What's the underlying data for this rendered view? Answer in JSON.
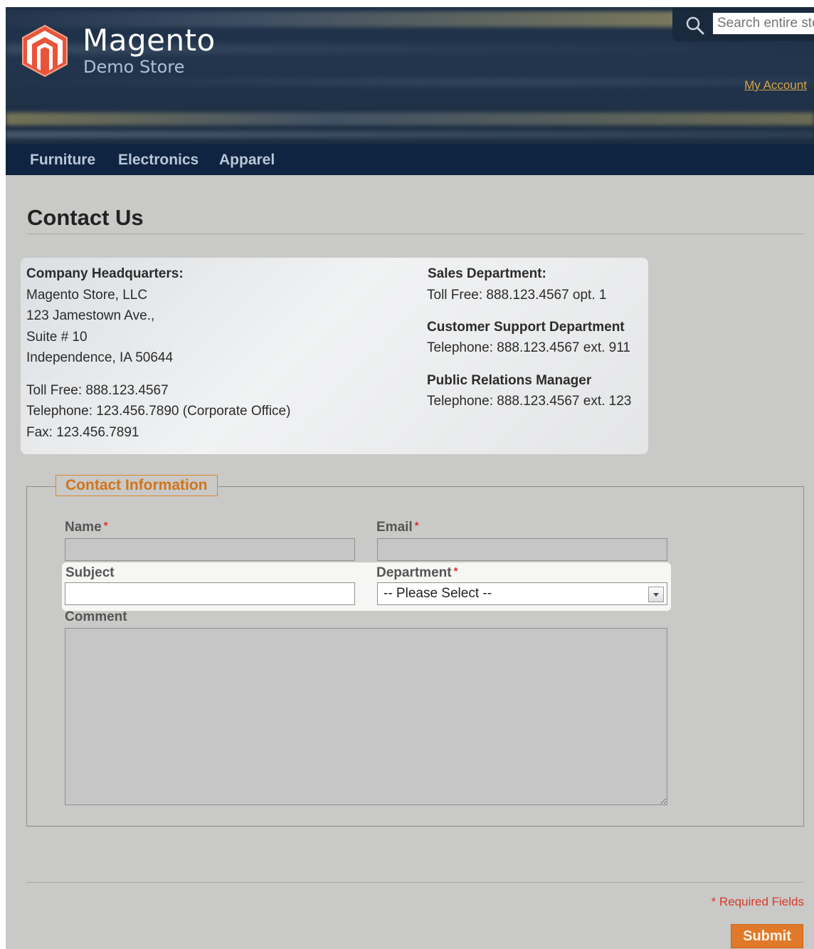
{
  "header": {
    "logo_title": "Magento",
    "logo_subtitle": "Demo Store",
    "search_placeholder": "Search entire store here...",
    "my_account": "My Account"
  },
  "nav": {
    "items": [
      "Furniture",
      "Electronics",
      "Apparel"
    ]
  },
  "page": {
    "title": "Contact Us"
  },
  "contact_info": {
    "hq_heading": "Company Headquarters:",
    "hq_lines": [
      "Magento Store, LLC",
      "123 Jamestown Ave.,",
      "Suite # 10",
      "Independence, IA 50644"
    ],
    "phone_lines": [
      "Toll Free: 888.123.4567",
      "Telephone: 123.456.7890 (Corporate Office)",
      "Fax: 123.456.7891"
    ],
    "sales_heading": "Sales Department:",
    "sales_line": "Toll Free: 888.123.4567 opt. 1",
    "support_heading": "Customer Support Department",
    "support_line": "Telephone: 888.123.4567 ext. 911",
    "pr_heading": "Public Relations Manager",
    "pr_line": "Telephone: 888.123.4567 ext. 123"
  },
  "form": {
    "legend": "Contact Information",
    "name_label": "Name",
    "email_label": "Email",
    "subject_label": "Subject",
    "department_label": "Department",
    "department_selected": "-- Please Select --",
    "comment_label": "Comment",
    "required_marker": "*",
    "required_note": "* Required Fields",
    "submit_label": "Submit"
  },
  "colors": {
    "header_bg": "#1f3047",
    "nav_bg": "#0f2440",
    "accent_orange": "#e0792a",
    "legend_orange": "#d0741b",
    "link_gold": "#d4a447",
    "required_red": "#e02b27",
    "page_bg": "#c9c9c7"
  }
}
